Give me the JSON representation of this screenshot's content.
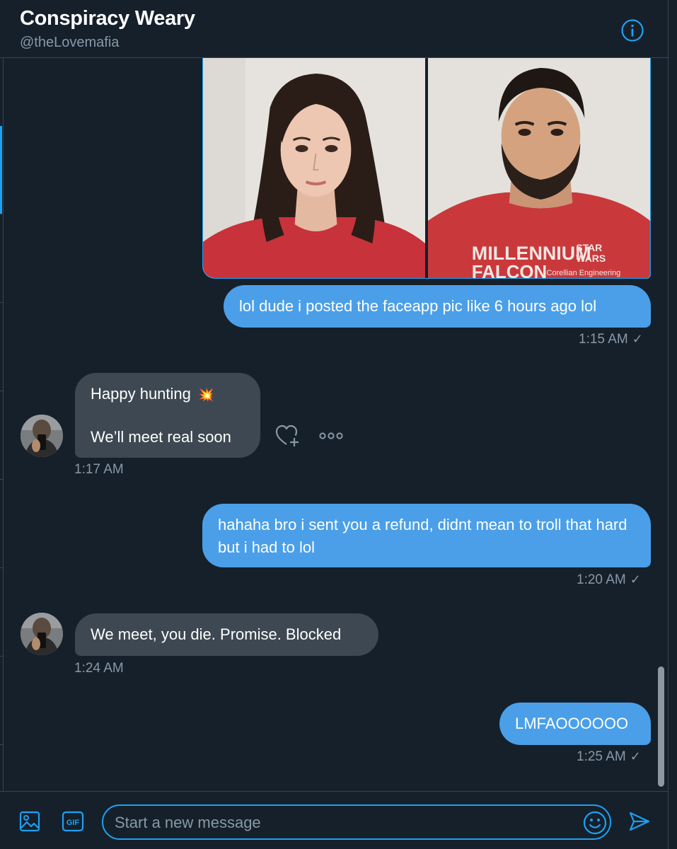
{
  "header": {
    "title": "Conspiracy Weary",
    "handle": "@theLovemafia"
  },
  "messages": [
    {
      "direction": "outgoing",
      "text": "lol dude i posted the faceapp pic like 6 hours ago lol",
      "time": "1:15 AM",
      "status": "✓"
    },
    {
      "direction": "incoming",
      "line1": "Happy hunting",
      "emoji": "💥",
      "line2": "We’ll meet real soon",
      "time": "1:17 AM"
    },
    {
      "direction": "outgoing",
      "text": "hahaha bro i sent you a refund, didnt mean to troll that hard but i had to lol",
      "time": "1:20 AM",
      "status": "✓"
    },
    {
      "direction": "incoming",
      "text": "We meet, you die. Promise. Blocked",
      "time": "1:24 AM"
    },
    {
      "direction": "outgoing",
      "text": "LMFAOOOOOO",
      "time": "1:25 AM",
      "status": "✓"
    }
  ],
  "photo_shirt_text": {
    "line1": "MILLENNIUM",
    "line2": "FALCON",
    "brand1": "STAR",
    "brand2": "WARS",
    "small": "Corellian Engineering"
  },
  "composer": {
    "placeholder": "Start a new message",
    "gif_label": "GIF"
  },
  "colors": {
    "background": "#15202b",
    "outgoing_bubble": "#4a9fe8",
    "incoming_bubble": "#3d4852",
    "accent": "#1da1f2",
    "muted_text": "#8899a6"
  },
  "icons": [
    "info-icon",
    "like-plus-icon",
    "more-icon",
    "image-icon",
    "gif-icon",
    "emoji-icon",
    "send-icon"
  ]
}
